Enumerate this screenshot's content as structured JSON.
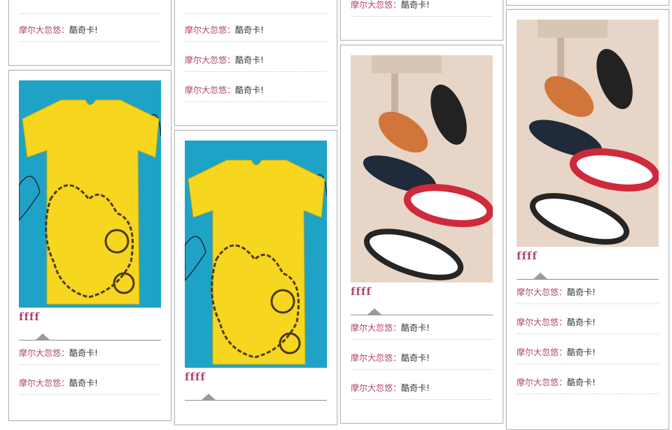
{
  "comment": {
    "user": "摩尔大忽悠",
    "sep": "：",
    "text": "酷奇卡!"
  },
  "cards": {
    "tshirt1": {
      "title": "ffff"
    },
    "tshirt2": {
      "title": "ffff"
    },
    "shoes1": {
      "title": "ffff"
    },
    "shoes2": {
      "title": "ffff"
    }
  },
  "colors": {
    "accent": "#b1436b",
    "tshirt": "#f7d91a",
    "bg_blue": "#1aa2c4",
    "tile": "#e5d5c6"
  },
  "icons": [
    "triangle-up-icon"
  ]
}
